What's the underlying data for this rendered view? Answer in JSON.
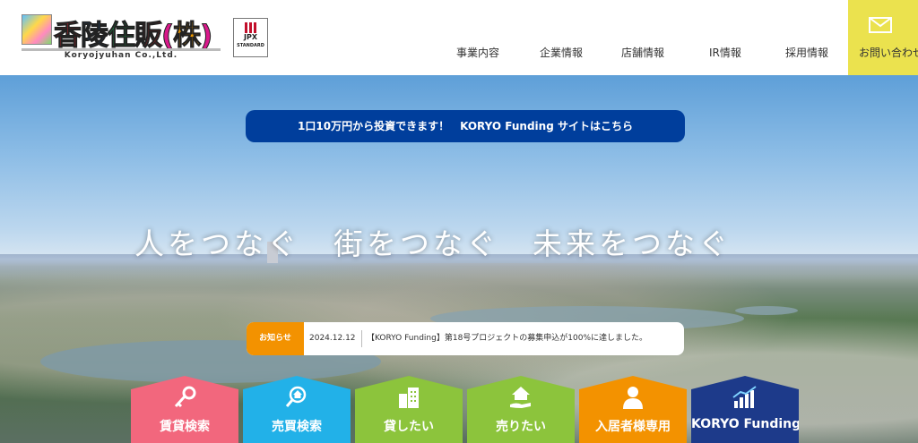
{
  "logo": {
    "title": "香陵住販(株)",
    "subtitle": "Koryojyuhan Co.,Ltd."
  },
  "jpx": {
    "line1": "JPX",
    "line2": "STANDARD"
  },
  "nav": [
    {
      "label": "事業内容"
    },
    {
      "label": "企業情報"
    },
    {
      "label": "店舗情報"
    },
    {
      "label": "IR情報"
    },
    {
      "label": "採用情報"
    }
  ],
  "contact": {
    "label": "お問い合わせ",
    "icon": "mail-icon",
    "color": "#ebe24e"
  },
  "banner": {
    "text": "1口10万円から投資できます！　KORYO Funding サイトはこちら",
    "color": "#003e9c"
  },
  "hero": {
    "catchphrase": "人をつなぐ　街をつなぐ　未来をつなぐ"
  },
  "news": {
    "badge": "お知らせ",
    "date": "2024.12.12",
    "text": "【KORYO Funding】第18号プロジェクトの募集申込が100%に達しました。",
    "badge_color": "#f39200"
  },
  "tiles": [
    {
      "label": "賃貸検索",
      "icon": "key-icon",
      "color": "#f2677d"
    },
    {
      "label": "売買検索",
      "icon": "house-search-icon",
      "color": "#22b1e8"
    },
    {
      "label": "貸したい",
      "icon": "building-icon",
      "color": "#8cc43c"
    },
    {
      "label": "売りたい",
      "icon": "house-hand-icon",
      "color": "#8cc43c"
    },
    {
      "label": "入居者様専用",
      "icon": "person-icon",
      "color": "#f39200"
    },
    {
      "label": "KORYO Funding",
      "icon": "chart-icon",
      "color": "#1d3a8a"
    }
  ]
}
